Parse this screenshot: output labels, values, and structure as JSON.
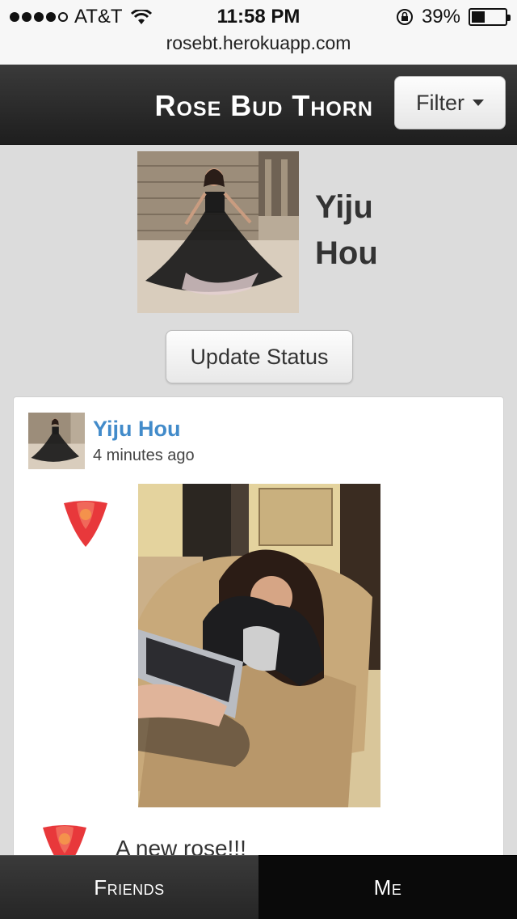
{
  "status_bar": {
    "carrier": "AT&T",
    "time": "11:58 PM",
    "battery": "39%",
    "battery_level": 0.39,
    "signal_bars_filled": 4,
    "signal_bars_total": 5
  },
  "browser": {
    "url": "rosebt.herokuapp.com"
  },
  "header": {
    "title": "Rose Bud Thorn",
    "filter_label": "Filter"
  },
  "profile": {
    "name_first": "Yiju",
    "name_last": "Hou",
    "update_label": "Update Status"
  },
  "post": {
    "author": "Yiju Hou",
    "time_ago": "4 minutes ago",
    "caption": "A new rose!!!"
  },
  "tabs": [
    {
      "label": "Friends"
    },
    {
      "label": "Me"
    }
  ],
  "colors": {
    "rose": "#e8383b",
    "link": "#428bca",
    "header_bg": "#2b2b2b"
  }
}
